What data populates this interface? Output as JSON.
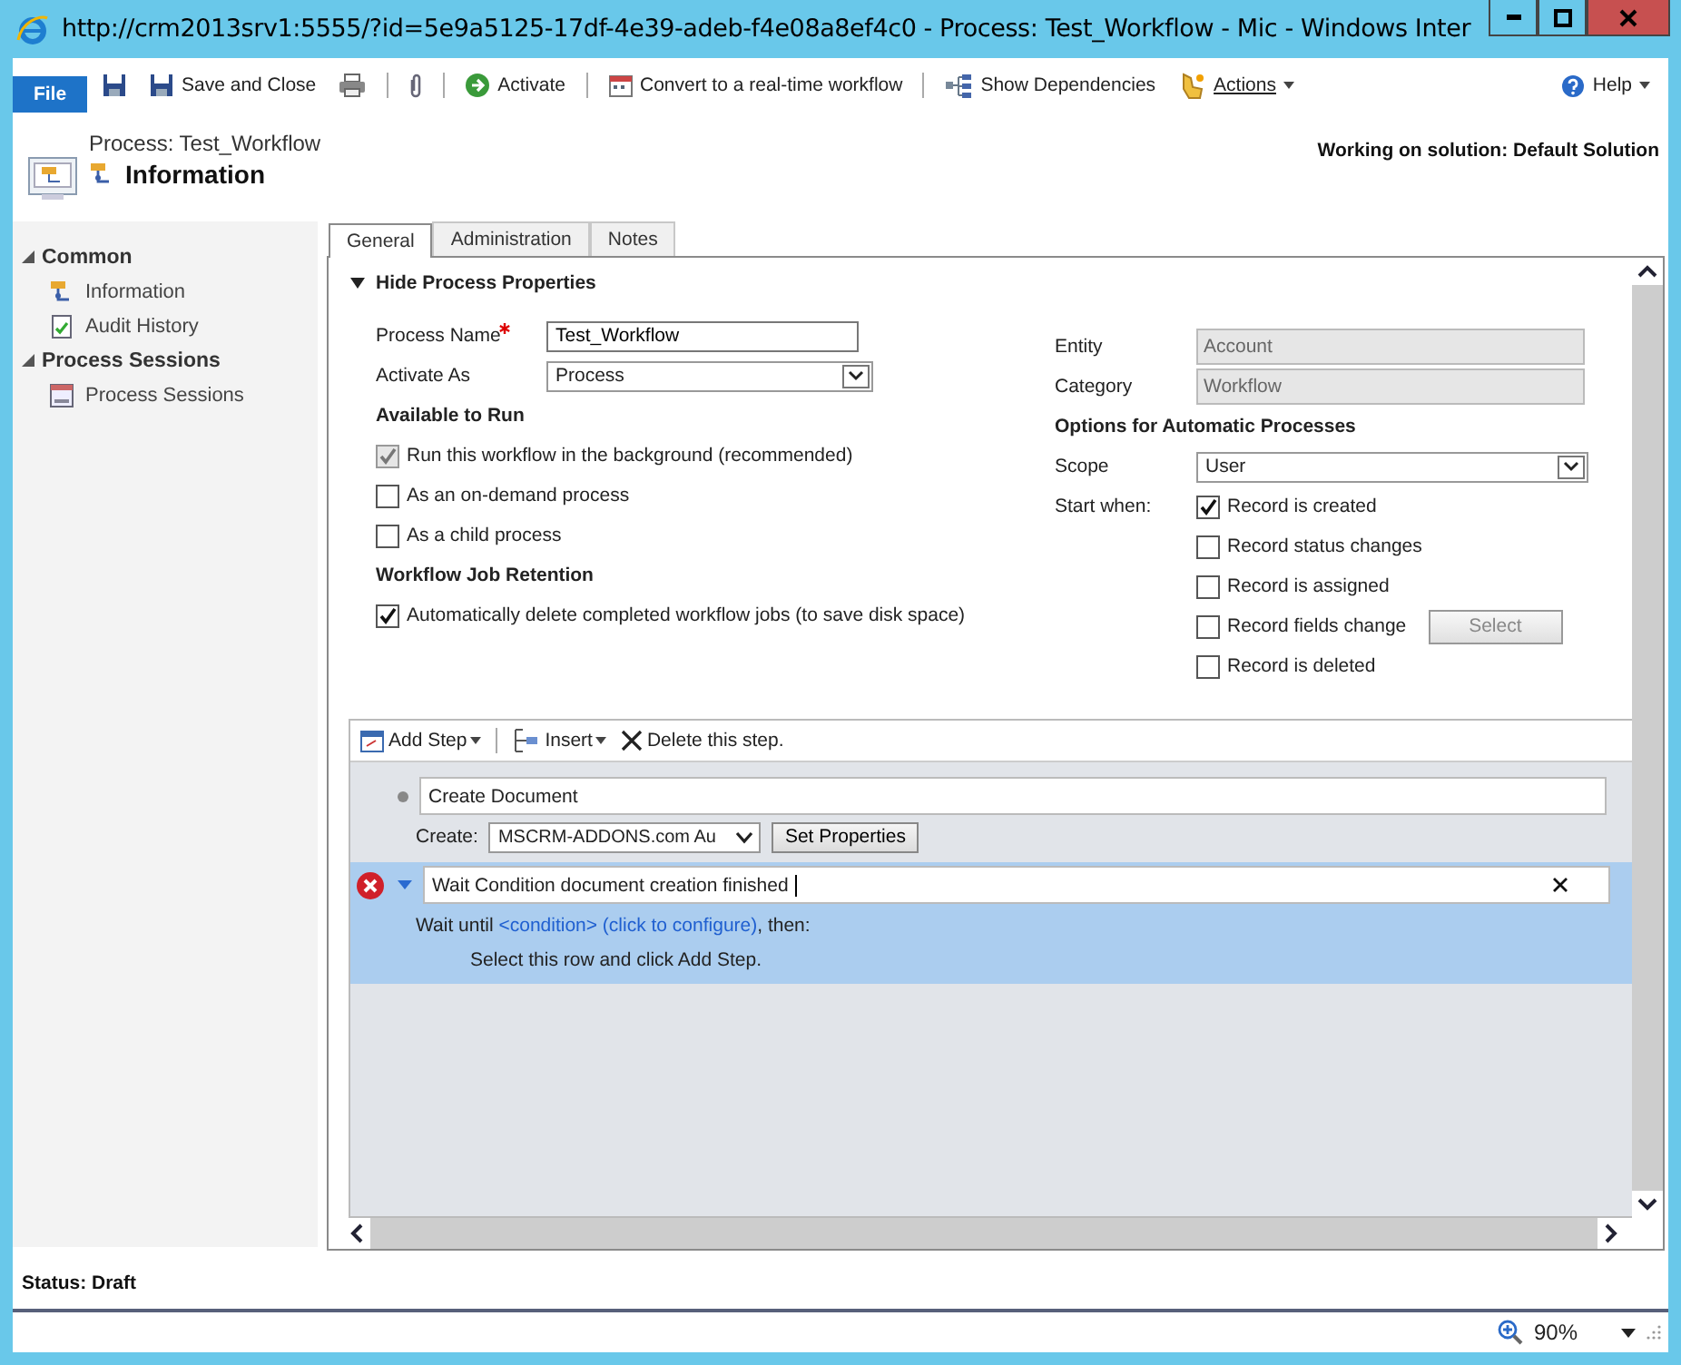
{
  "window": {
    "title": "http://crm2013srv1:5555/?id=5e9a5125-17df-4e39-adeb-f4e08a8ef4c0 - Process: Test_Workflow - Mic - Windows Inter"
  },
  "ribbon": {
    "file_tab": "File",
    "items": [
      {
        "kind": "save"
      },
      {
        "kind": "save-close",
        "label": "Save and Close"
      },
      {
        "kind": "print"
      },
      {
        "kind": "separator"
      },
      {
        "kind": "attach"
      },
      {
        "kind": "separator"
      },
      {
        "kind": "activate",
        "label": "Activate"
      },
      {
        "kind": "separator"
      },
      {
        "kind": "convert",
        "label": "Convert to a real-time workflow"
      },
      {
        "kind": "separator"
      },
      {
        "kind": "dependencies",
        "label": "Show Dependencies"
      },
      {
        "kind": "actions",
        "label": "Actions"
      }
    ],
    "help": "Help"
  },
  "header": {
    "breadcrumb": "Process: Test_Workflow",
    "title": "Information",
    "solution": "Working on solution: Default Solution"
  },
  "sidebar": {
    "groups": [
      {
        "label": "Common",
        "expanded": true,
        "items": [
          {
            "label": "Information",
            "kind": "info"
          },
          {
            "label": "Audit History",
            "kind": "audit"
          }
        ]
      },
      {
        "label": "Process Sessions",
        "expanded": true,
        "items": [
          {
            "label": "Process Sessions",
            "kind": "sessions"
          }
        ]
      }
    ]
  },
  "tabs": [
    {
      "label": "General",
      "selected": true
    },
    {
      "label": "Administration",
      "selected": false
    },
    {
      "label": "Notes",
      "selected": false
    }
  ],
  "section": {
    "title": "Hide Process Properties",
    "expanded": true
  },
  "left": {
    "process_name": {
      "label": "Process Name",
      "required": true,
      "value": "Test_Workflow"
    },
    "activate_as": {
      "label": "Activate As",
      "value": "Process"
    },
    "available_heading": "Available to Run",
    "available_options": [
      {
        "label": "Run this workflow in the background (recommended)",
        "checked": true,
        "disabled": true
      },
      {
        "label": "As an on-demand process",
        "checked": false,
        "disabled": false
      },
      {
        "label": "As a child process",
        "checked": false,
        "disabled": false
      }
    ],
    "retention_heading": "Workflow Job Retention",
    "retention_options": [
      {
        "label": "Automatically delete completed workflow jobs (to save disk space)",
        "checked": true,
        "disabled": false
      }
    ]
  },
  "right": {
    "entity": {
      "label": "Entity",
      "value": "Account"
    },
    "category": {
      "label": "Category",
      "value": "Workflow"
    },
    "options_heading": "Options for Automatic Processes",
    "scope": {
      "label": "Scope",
      "value": "User"
    },
    "start_when_label": "Start when:",
    "start_options": [
      {
        "label": "Record is created",
        "checked": true
      },
      {
        "label": "Record status changes",
        "checked": false
      },
      {
        "label": "Record is assigned",
        "checked": false
      },
      {
        "label": "Record fields change",
        "checked": false,
        "button": "Select"
      },
      {
        "label": "Record is deleted",
        "checked": false
      }
    ]
  },
  "steps_toolbar": {
    "add_step": "Add Step",
    "insert": "Insert",
    "delete": "Delete this step."
  },
  "steps": [
    {
      "kind": "action",
      "selected": false,
      "error": false,
      "description": "Create Document",
      "create_label": "Create:",
      "create_value": "MSCRM-ADDONS.com Au",
      "button": "Set Properties"
    },
    {
      "kind": "wait",
      "selected": true,
      "error": true,
      "description": "Wait Condition document creation finished",
      "wait_label": "Wait until",
      "condition": "<condition> (click to configure)",
      "then": ", then:",
      "hint": "Select this row and click Add Step."
    }
  ],
  "status": "Status: Draft",
  "zoom": "90%"
}
